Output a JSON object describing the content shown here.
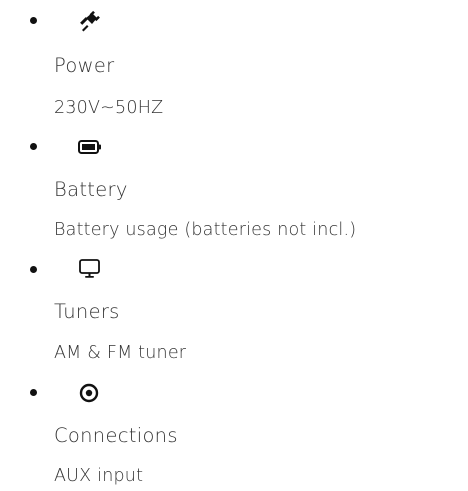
{
  "specs": [
    {
      "icon": "plug-icon",
      "label": "Power",
      "value": "230V~50HZ"
    },
    {
      "icon": "battery-icon",
      "label": "Battery",
      "value": "Battery usage (batteries not incl.)"
    },
    {
      "icon": "monitor-icon",
      "label": "Tuners",
      "value": "AM & FM tuner"
    },
    {
      "icon": "target-icon",
      "label": "Connections",
      "value": "AUX input"
    }
  ]
}
